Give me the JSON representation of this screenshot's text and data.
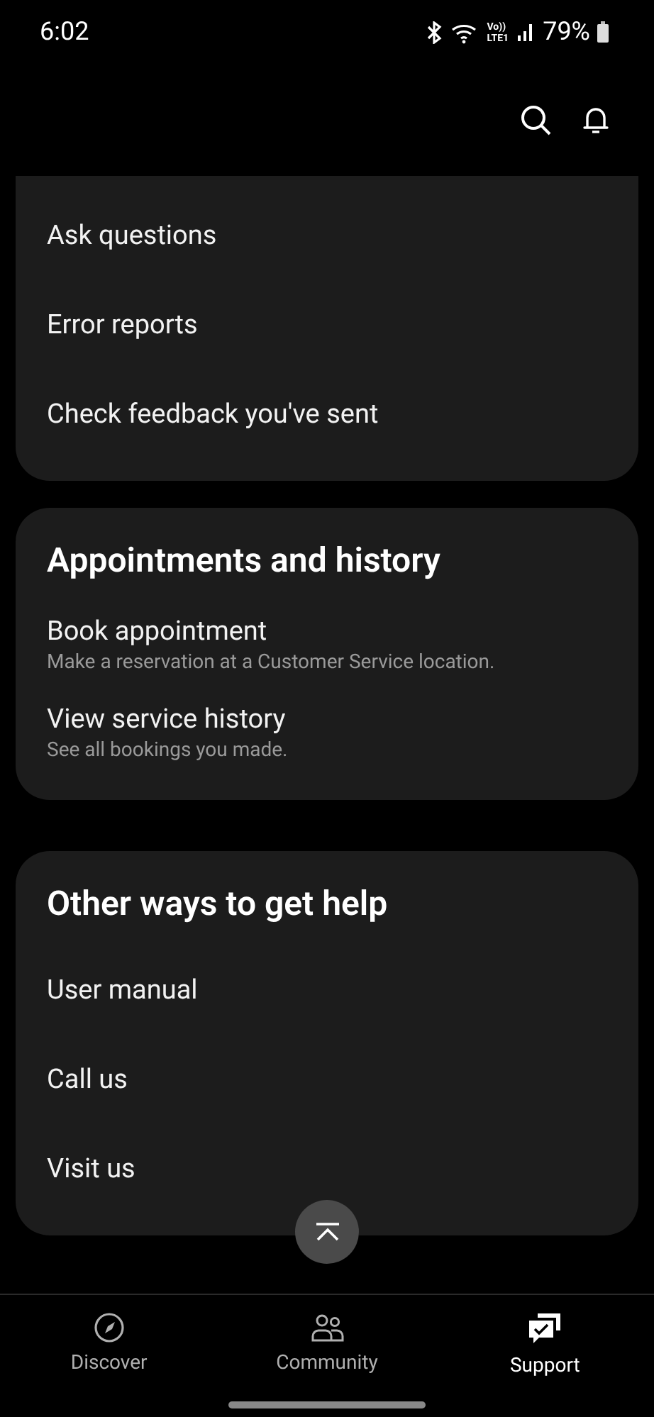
{
  "status_bar": {
    "time": "6:02",
    "battery": "79%",
    "network": "Vo))\nLTE1"
  },
  "sections": [
    {
      "items": [
        {
          "label": "Ask questions"
        },
        {
          "label": "Error reports"
        },
        {
          "label": "Check feedback you've sent"
        }
      ]
    },
    {
      "title": "Appointments and history",
      "items": [
        {
          "label": "Book appointment",
          "subtitle": "Make a reservation at a Customer Service location."
        },
        {
          "label": "View service history",
          "subtitle": "See all bookings you made."
        }
      ]
    },
    {
      "title": "Other ways to get help",
      "items": [
        {
          "label": "User manual"
        },
        {
          "label": "Call us"
        },
        {
          "label": "Visit us"
        }
      ]
    }
  ],
  "bottom_nav": [
    {
      "label": "Discover",
      "kind": "compass",
      "selected": false
    },
    {
      "label": "Community",
      "kind": "people",
      "selected": false
    },
    {
      "label": "Support",
      "kind": "chat",
      "selected": true
    }
  ]
}
